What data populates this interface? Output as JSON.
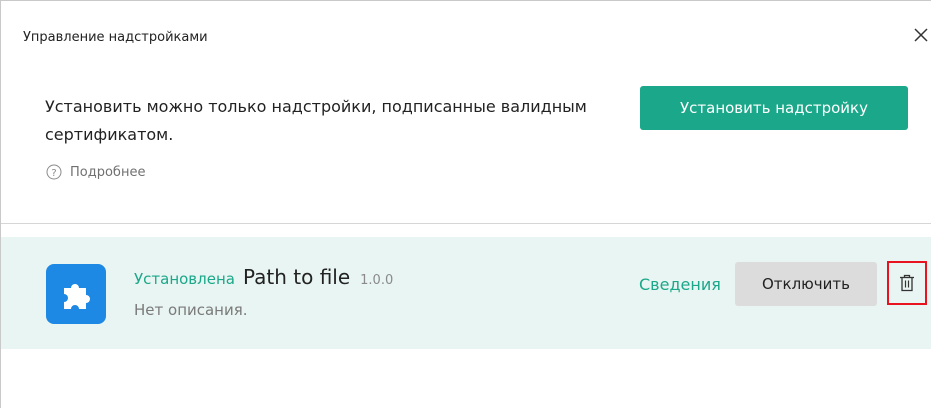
{
  "dialog": {
    "title": "Управление надстройками",
    "notice": "Установить можно только надстройки, подписанные валидным сертификатом.",
    "install_button": "Установить надстройку",
    "more_link": "Подробнее"
  },
  "addon": {
    "status": "Установлена",
    "name": "Path to file",
    "version": "1.0.0",
    "description": "Нет описания.",
    "details_link": "Сведения",
    "disable_button": "Отключить"
  },
  "colors": {
    "accent": "#1ba789",
    "row_background": "#e8f5f2",
    "addon_icon": "#1e88e5",
    "highlight": "#e8131f"
  },
  "icons": {
    "close": "close-icon",
    "help": "question-circle-icon",
    "addon": "puzzle-icon",
    "delete": "trash-icon"
  }
}
